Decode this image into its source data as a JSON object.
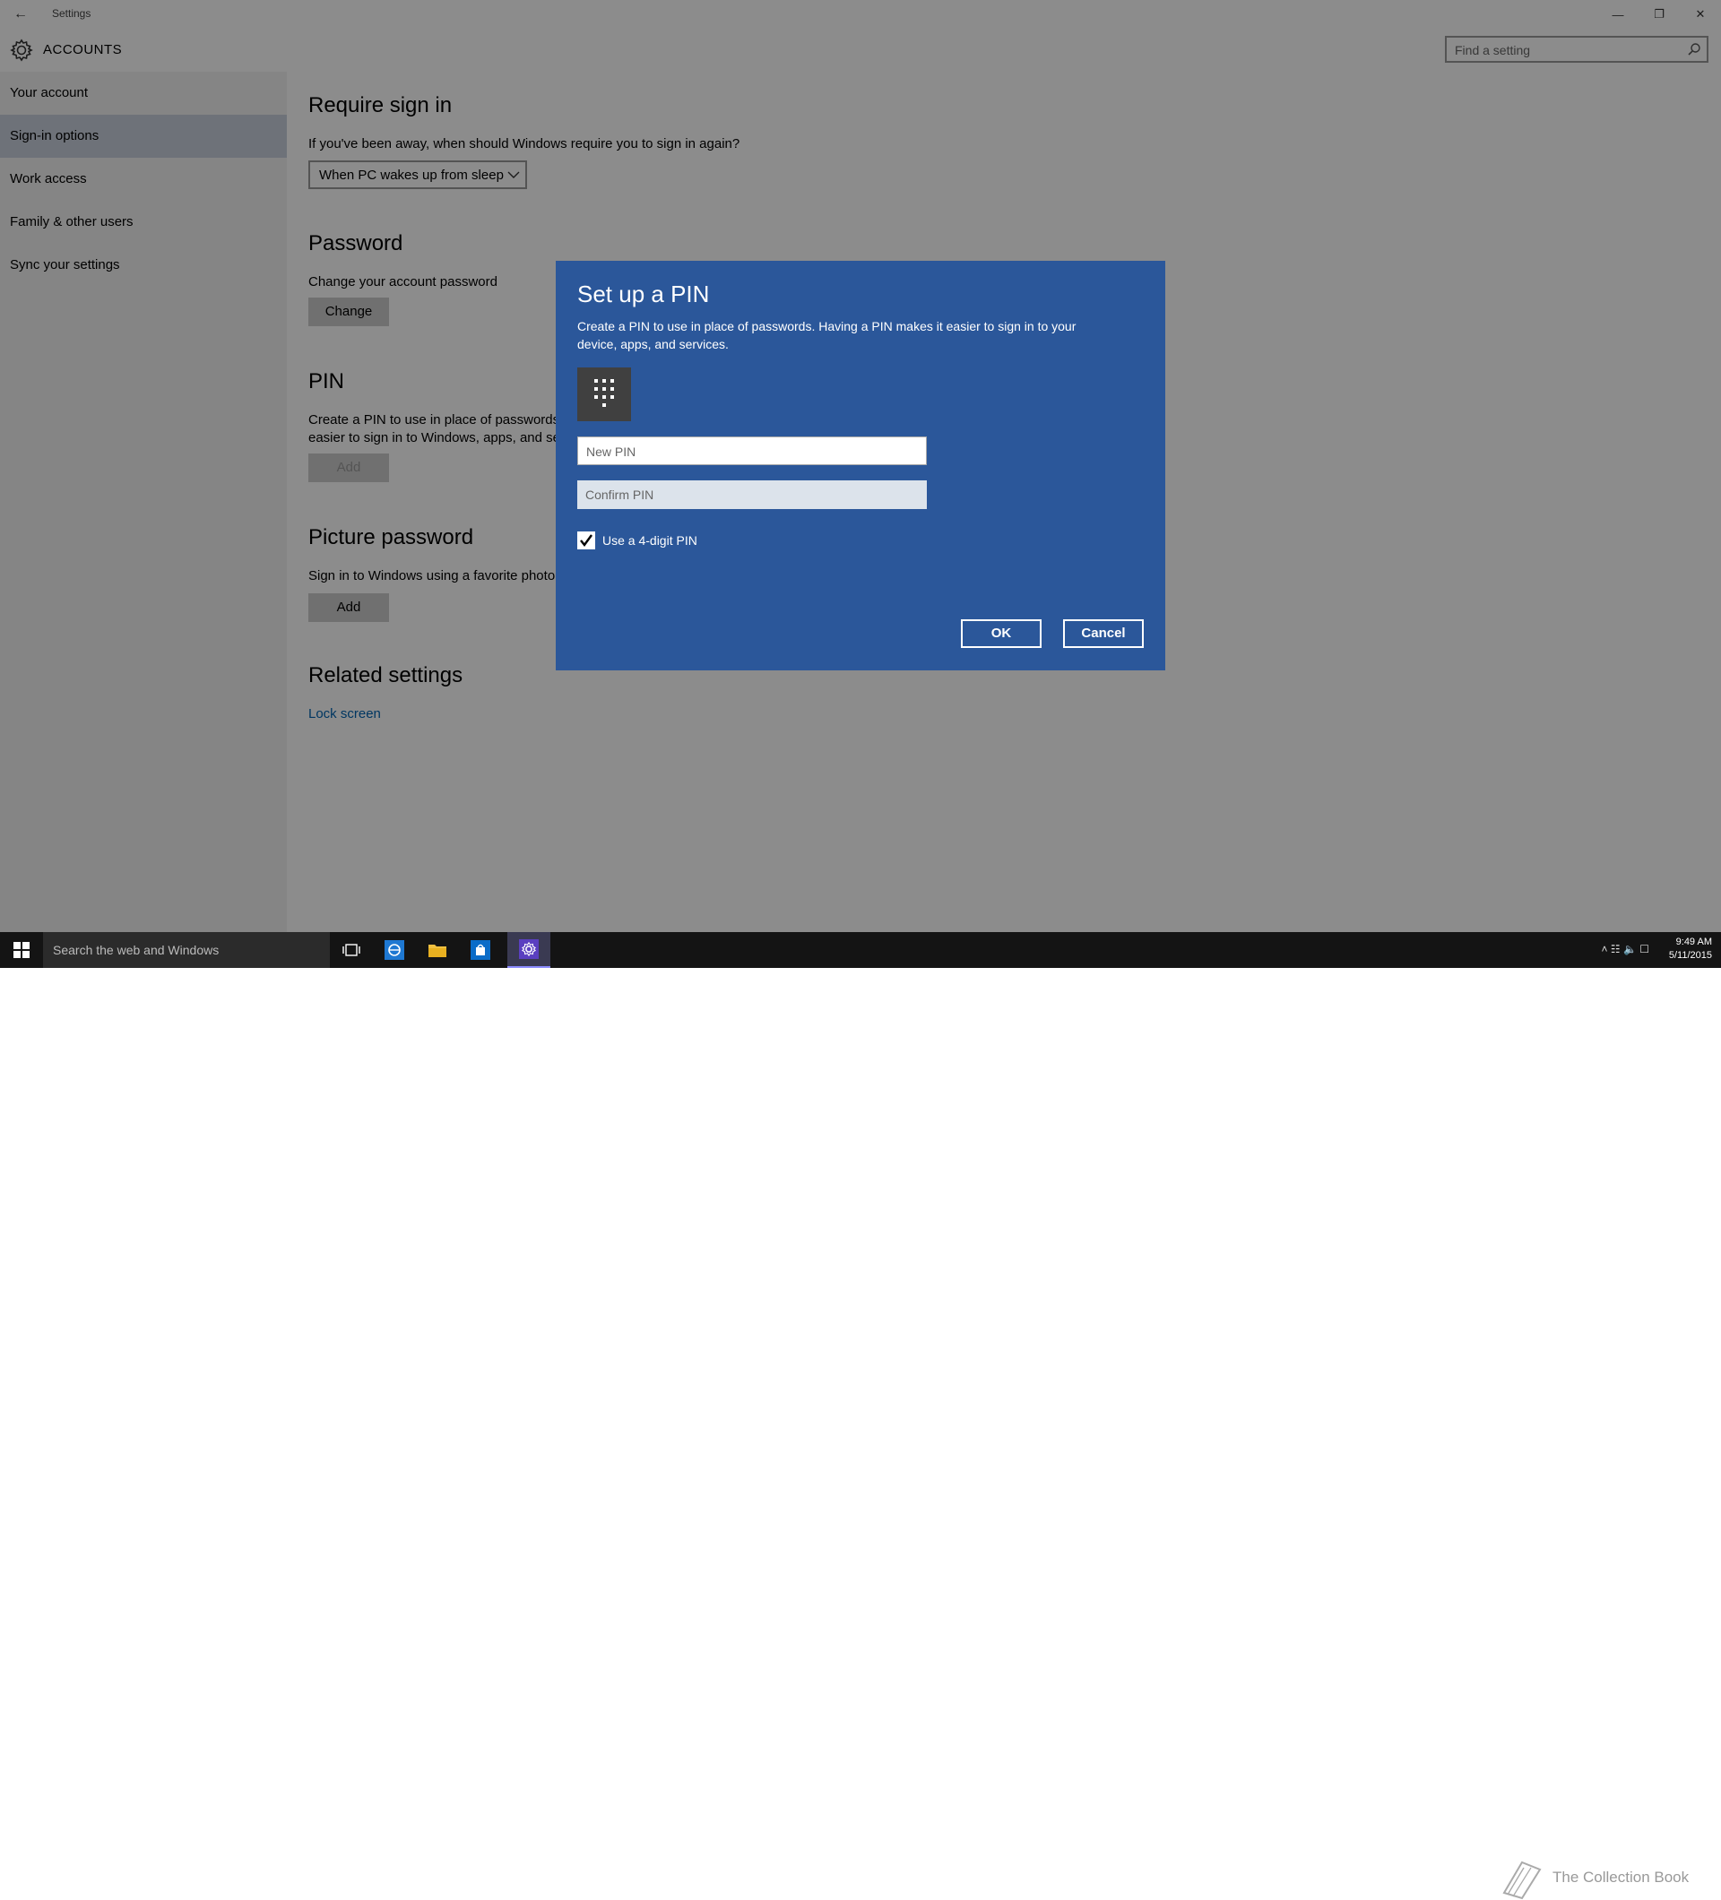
{
  "window": {
    "title": "Settings",
    "back_glyph": "←",
    "minimize_glyph": "—",
    "maximize_glyph": "❐",
    "close_glyph": "✕"
  },
  "header": {
    "section": "ACCOUNTS",
    "icon": "gear-icon",
    "search_placeholder": "Find a setting"
  },
  "sidebar": {
    "items": [
      {
        "label": "Your account",
        "active": false
      },
      {
        "label": "Sign-in options",
        "active": true
      },
      {
        "label": "Work access",
        "active": false
      },
      {
        "label": "Family & other users",
        "active": false
      },
      {
        "label": "Sync your settings",
        "active": false
      }
    ]
  },
  "content": {
    "require": {
      "title": "Require sign in",
      "question": "If you've been away, when should Windows require you to sign in again?",
      "dropdown_value": "When PC wakes up from sleep"
    },
    "password": {
      "title": "Password",
      "desc": "Change your account password",
      "button": "Change"
    },
    "pin": {
      "title": "PIN",
      "desc_line1": "Create a PIN to use in place of passwords.",
      "desc_line2": "easier to sign in to Windows, apps, and se",
      "button": "Add"
    },
    "picture": {
      "title": "Picture password",
      "desc": "Sign in to Windows using a favorite photo",
      "button": "Add"
    },
    "related": {
      "title": "Related settings",
      "link": "Lock screen"
    }
  },
  "dialog": {
    "title": "Set up a PIN",
    "desc": "Create a PIN to use in place of passwords. Having a PIN makes it easier to sign in to your device, apps, and services.",
    "icon": "keypad-icon",
    "new_pin_placeholder": "New PIN",
    "confirm_pin_placeholder": "Confirm PIN",
    "checkbox_label": "Use a 4-digit PIN",
    "checkbox_checked": true,
    "ok": "OK",
    "cancel": "Cancel",
    "bg_color": "#2b579a"
  },
  "taskbar": {
    "search_text": "Search the web and Windows",
    "watermark": "The Collection Book",
    "time": "9:49 AM",
    "date": "5/11/2015",
    "icons": [
      "windows-logo-icon",
      "task-view-icon",
      "edge-icon",
      "file-explorer-icon",
      "store-icon",
      "settings-icon"
    ]
  },
  "colors": {
    "accent": "#0063b1",
    "dialog": "#2b579a",
    "taskbar": "#141414"
  }
}
